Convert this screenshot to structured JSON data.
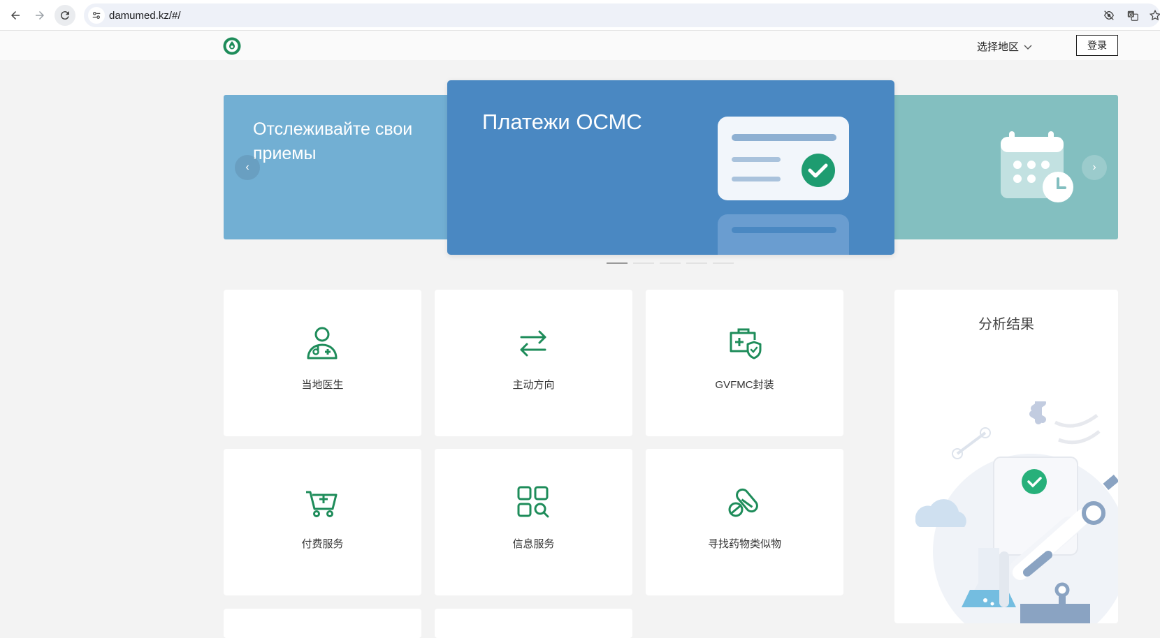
{
  "browser": {
    "url": "damumed.kz/#/"
  },
  "header": {
    "region_label": "选择地区",
    "login_label": "登录"
  },
  "carousel": {
    "slides": [
      {
        "title": "Отслеживайте свои приемы"
      },
      {
        "title": "Платежи ОСМС"
      }
    ],
    "prev_label": "‹",
    "next_label": "›",
    "active_index": 0,
    "dot_count": 5
  },
  "services": [
    {
      "label": "当地医生",
      "icon": "doctor-icon"
    },
    {
      "label": "主动方向",
      "icon": "arrows-exchange-icon"
    },
    {
      "label": "GVFMC封装",
      "icon": "medical-kit-shield-icon"
    },
    {
      "label": "付费服务",
      "icon": "medical-cart-icon"
    },
    {
      "label": "信息服务",
      "icon": "grid-search-icon"
    },
    {
      "label": "寻找药物类似物",
      "icon": "pills-icon"
    }
  ],
  "results": {
    "title": "分析结果"
  },
  "colors": {
    "accent_green": "#1e8c5a",
    "slide_left": "#72afd3",
    "slide_center": "#4a88c2",
    "slide_right": "#83bfc0"
  }
}
